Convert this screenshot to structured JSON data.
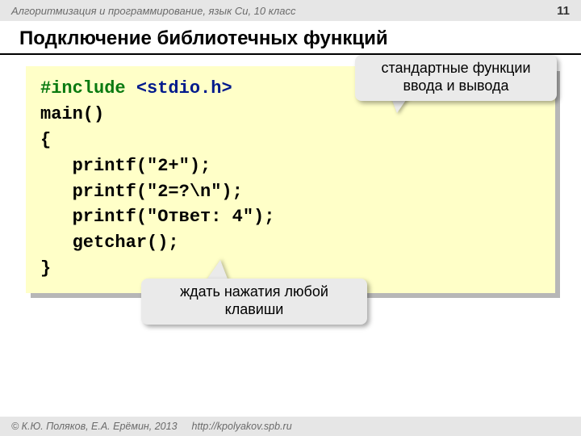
{
  "header": {
    "course": "Алгоритмизация и программирование, язык Си, 10 класс",
    "page": "11"
  },
  "title": "Подключение библиотечных функций",
  "code": {
    "l1a": "#include ",
    "l1b": "<stdio.h>",
    "l2": "main()",
    "l3": "{",
    "l4": "   printf(\"2+\");",
    "l5": "   printf(\"2=?\\n\");",
    "l6": "   printf(\"Ответ: 4\");",
    "l7": "   getchar();",
    "l8": "}"
  },
  "callouts": {
    "io": "стандартные функции ввода и вывода",
    "key": "ждать нажатия любой клавиши"
  },
  "footer": {
    "credit": "© К.Ю. Поляков, Е.А. Ерёмин, 2013",
    "link": "http://kpolyakov.spb.ru"
  }
}
